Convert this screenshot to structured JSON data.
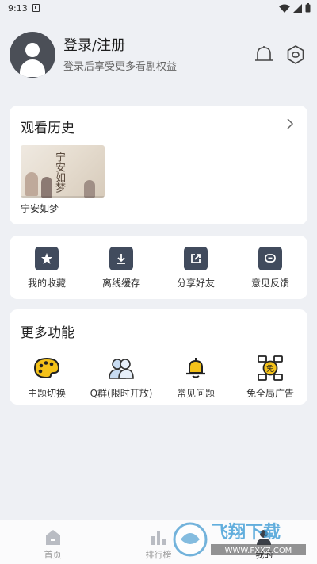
{
  "status_bar": {
    "time": "9:13"
  },
  "profile": {
    "title": "登录/注册",
    "subtitle": "登录后享受更多看剧权益"
  },
  "history": {
    "title": "观看历史",
    "items": [
      {
        "name": "宁安如梦",
        "thumb_text": "宁安如梦"
      }
    ]
  },
  "actions": [
    {
      "label": "我的收藏",
      "icon": "star-icon"
    },
    {
      "label": "离线缓存",
      "icon": "download-icon"
    },
    {
      "label": "分享好友",
      "icon": "share-icon"
    },
    {
      "label": "意见反馈",
      "icon": "feedback-icon"
    }
  ],
  "more": {
    "title": "更多功能",
    "items": [
      {
        "label": "主题切换",
        "icon": "palette-icon"
      },
      {
        "label": "Q群(限时开放)",
        "icon": "group-icon"
      },
      {
        "label": "常见问题",
        "icon": "bell-icon"
      },
      {
        "label": "免全局广告",
        "icon": "ad-free-icon"
      }
    ]
  },
  "tabbar": [
    {
      "label": "首页",
      "active": false
    },
    {
      "label": "排行榜",
      "active": false
    },
    {
      "label": "我的",
      "active": true
    }
  ],
  "watermark": {
    "text": "飞翔下载",
    "url": "WWW.FXXZ.COM"
  },
  "colors": {
    "icon_dark": "#414b5d",
    "accent_yellow": "#f4c21a",
    "background": "#eef0f4"
  }
}
